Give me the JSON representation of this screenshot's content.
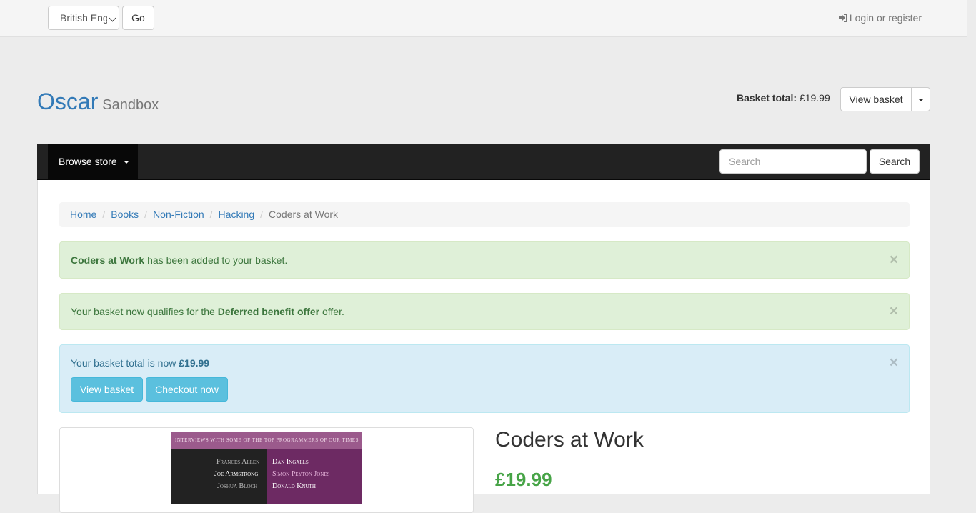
{
  "topbar": {
    "language_selected": "British English",
    "go_label": "Go",
    "login_label": "Login or register"
  },
  "header": {
    "brand_name": "Oscar",
    "brand_sub": "Sandbox",
    "basket_total_label": "Basket total:",
    "basket_total_value": "£19.99",
    "view_basket_label": "View basket"
  },
  "navbar": {
    "browse_label": "Browse store",
    "search_placeholder": "Search",
    "search_button": "Search"
  },
  "breadcrumb": {
    "items": [
      "Home",
      "Books",
      "Non-Fiction",
      "Hacking"
    ],
    "active": "Coders at Work"
  },
  "alerts": {
    "added": {
      "strong": "Coders at Work",
      "text": " has been added to your basket."
    },
    "offer": {
      "prefix": "Your basket now qualifies for the ",
      "strong": "Deferred benefit offer",
      "suffix": " offer."
    },
    "total": {
      "prefix": "Your basket total is now ",
      "strong": "£19.99",
      "view_basket": "View basket",
      "checkout": "Checkout now"
    },
    "close": "×"
  },
  "product": {
    "title": "Coders at Work",
    "price": "£19.99",
    "cover": {
      "tagline": "INTERVIEWS WITH SOME OF THE TOP PROGRAMMERS OF OUR TIMES",
      "left_names": [
        "Frances Allen",
        "Joe Armstrong",
        "Joshua Bloch"
      ],
      "right_names": [
        "Dan Ingalls",
        "Simon Peyton Jones",
        "Donald Knuth"
      ]
    }
  }
}
